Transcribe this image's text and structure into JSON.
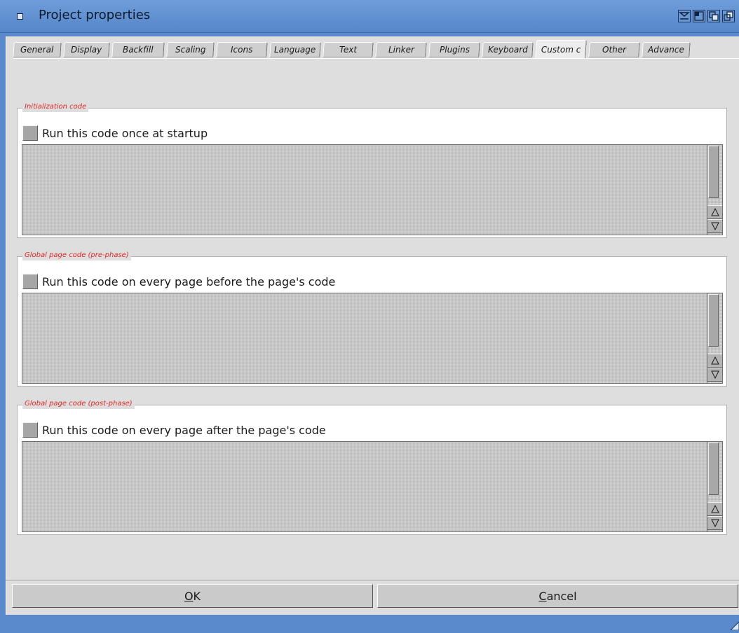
{
  "window": {
    "title": "Project properties"
  },
  "tabs": [
    {
      "label": "General",
      "active": false
    },
    {
      "label": "Display",
      "active": false
    },
    {
      "label": "Backfill",
      "active": false
    },
    {
      "label": "Scaling",
      "active": false
    },
    {
      "label": "Icons",
      "active": false
    },
    {
      "label": "Language",
      "active": false
    },
    {
      "label": "Text",
      "active": false
    },
    {
      "label": "Linker",
      "active": false
    },
    {
      "label": "Plugins",
      "active": false
    },
    {
      "label": "Keyboard",
      "active": false
    },
    {
      "label": "Custom c",
      "active": true
    },
    {
      "label": "Other",
      "active": false
    },
    {
      "label": "Advance",
      "active": false
    }
  ],
  "groups": [
    {
      "title": "Initialization code",
      "checkbox_label": "Run this code once at startup",
      "checked": false,
      "code": ""
    },
    {
      "title": "Global page code (pre-phase)",
      "checkbox_label": "Run this code on every page before the page's code",
      "checked": false,
      "code": ""
    },
    {
      "title": "Global page code (post-phase)",
      "checkbox_label": "Run this code on every page after the page's code",
      "checked": false,
      "code": ""
    }
  ],
  "buttons": {
    "ok": {
      "hotkey": "O",
      "rest": "K"
    },
    "cancel": {
      "hotkey": "C",
      "rest": "ancel"
    }
  },
  "colors": {
    "titlebar": "#5a8acb",
    "group_title": "#e02525",
    "panel": "#dedede"
  }
}
